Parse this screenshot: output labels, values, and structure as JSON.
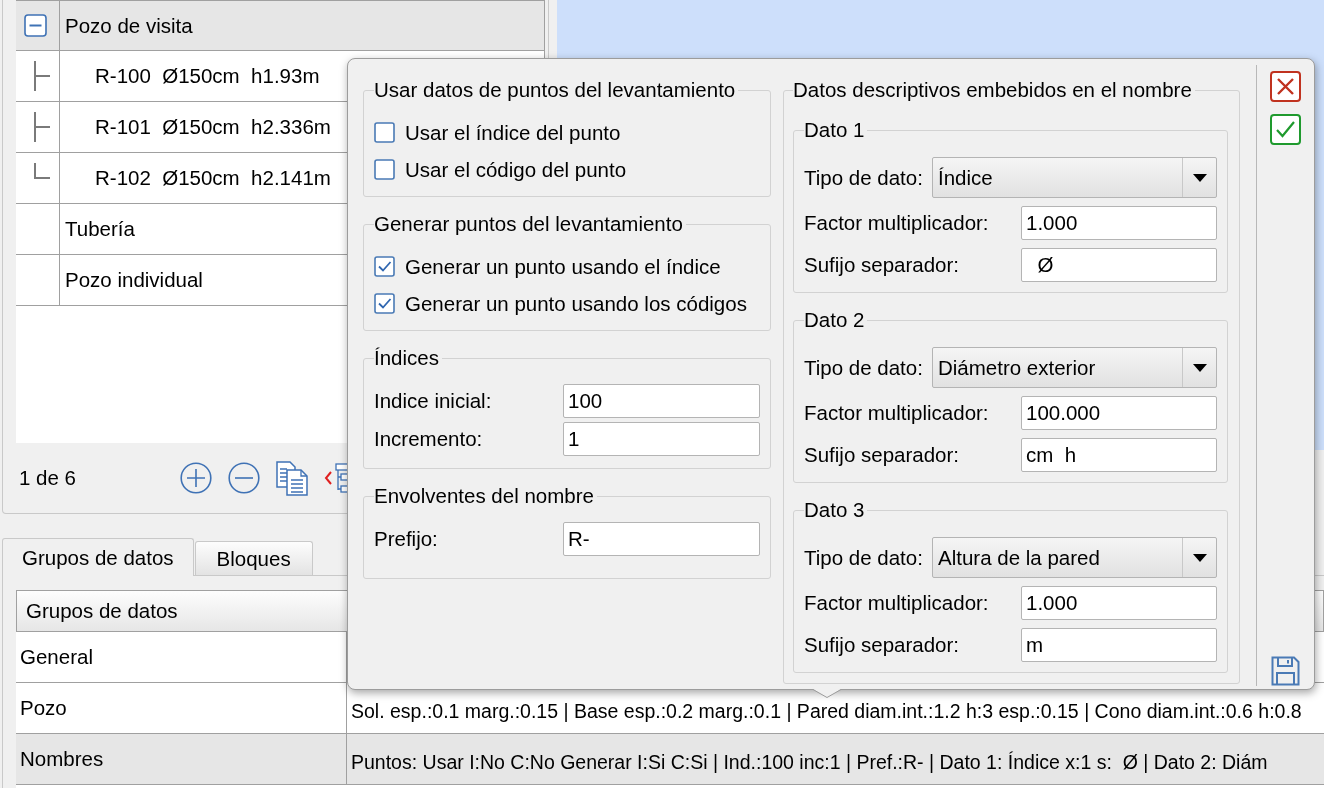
{
  "tree": {
    "items": [
      {
        "label": "Pozo de visita",
        "selected": true,
        "expanded": true,
        "children": [
          {
            "label": "R-100  Ø150cm  h1.93m",
            "selected": false
          },
          {
            "label": "R-101  Ø150cm  h2.336m",
            "selected": false
          },
          {
            "label": "R-102  Ø150cm  h2.141m",
            "selected": false
          }
        ]
      },
      {
        "label": "Tubería",
        "selected": false
      },
      {
        "label": "Pozo individual",
        "selected": false
      }
    ]
  },
  "pager": {
    "counter": "1 de 6"
  },
  "dialog": {
    "groups": [
      {
        "title": "Usar datos de puntos del levantamiento",
        "rows": [
          {
            "kind": "checkbox",
            "label": "Usar el índice del punto",
            "checked": false
          },
          {
            "kind": "checkbox",
            "label": "Usar el código del punto",
            "checked": false
          }
        ]
      },
      {
        "title": "Generar puntos del levantamiento",
        "rows": [
          {
            "kind": "checkbox",
            "label": "Generar un punto usando el índice",
            "checked": true
          },
          {
            "kind": "checkbox",
            "label": "Generar un punto usando los códigos",
            "checked": true
          }
        ]
      },
      {
        "title": "Índices",
        "rows": [
          {
            "kind": "text",
            "label": "Indice inicial:",
            "value": "100"
          },
          {
            "kind": "text",
            "label": "Incremento:",
            "value": "1"
          }
        ]
      },
      {
        "title": "Envolventes del nombre",
        "rows": [
          {
            "kind": "text",
            "label": "Prefijo:",
            "value": "R-"
          }
        ]
      }
    ],
    "embedded": {
      "title": "Datos descriptivos embebidos en el nombre",
      "items": [
        {
          "title": "Dato 1",
          "fields": [
            {
              "kind": "dropdown",
              "label": "Tipo de dato:",
              "value": "Índice"
            },
            {
              "kind": "text",
              "label": "Factor multiplicador:",
              "value": "1.000"
            },
            {
              "kind": "text",
              "label": "Sufijo separador:",
              "value": "  Ø"
            }
          ]
        },
        {
          "title": "Dato 2",
          "fields": [
            {
              "kind": "dropdown",
              "label": "Tipo de dato:",
              "value": "Diámetro exterior"
            },
            {
              "kind": "text",
              "label": "Factor multiplicador:",
              "value": "100.000"
            },
            {
              "kind": "text",
              "label": "Sufijo separador:",
              "value": "cm  h"
            }
          ]
        },
        {
          "title": "Dato 3",
          "fields": [
            {
              "kind": "dropdown",
              "label": "Tipo de dato:",
              "value": "Altura de la pared"
            },
            {
              "kind": "text",
              "label": "Factor multiplicador:",
              "value": "1.000"
            },
            {
              "kind": "text",
              "label": "Sufijo separador:",
              "value": "m"
            }
          ]
        }
      ]
    }
  },
  "tabs": [
    {
      "label": "Grupos de datos",
      "selected": true
    },
    {
      "label": "Bloques",
      "selected": false
    }
  ],
  "table": {
    "columns": [
      "Grupos de datos"
    ],
    "rows": [
      {
        "group": "General",
        "selected": false
      },
      {
        "group": "Pozo",
        "value": "Sol. esp.:0.1 marg.:0.15 | Base esp.:0.2 marg.:0.1 | Pared diam.int.:1.2 h:3 esp.:0.15 | Cono diam.int.:0.6 h:0.8",
        "selected": false
      },
      {
        "group": "Nombres",
        "value": "Puntos: Usar I:No C:No Generar I:Si C:Si | Ind.:100 inc:1 | Pref.:R- | Dato 1: Índice x:1 s:  Ø | Dato 2: Diám",
        "selected": true
      }
    ]
  }
}
